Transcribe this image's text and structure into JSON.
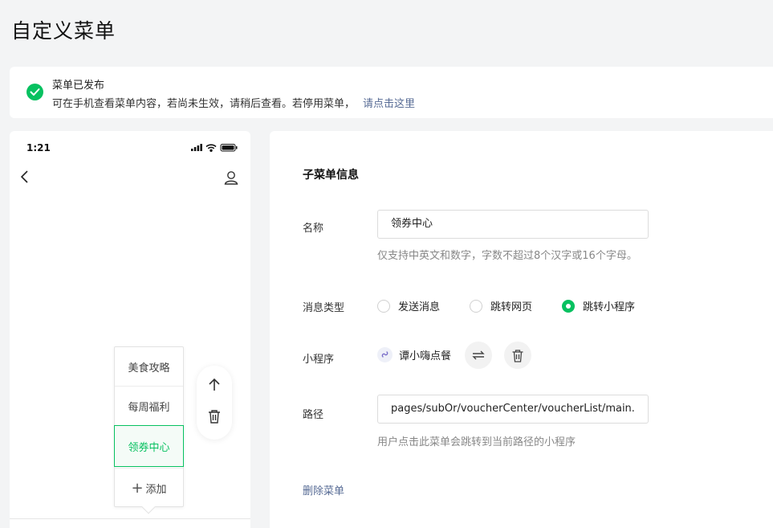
{
  "page": {
    "title": "自定义菜单"
  },
  "notice": {
    "title": "菜单已发布",
    "description": "可在手机查看菜单内容，若尚未生效，请稍后查看。若停用菜单，",
    "link": "请点击这里"
  },
  "phone": {
    "time": "1:21",
    "submenu_items": [
      "美食攻略",
      "每周福利",
      "领券中心"
    ],
    "selected_item": "领券中心",
    "add_label": "添加"
  },
  "panel": {
    "section_title": "子菜单信息",
    "name": {
      "label": "名称",
      "value": "领券中心",
      "hint": "仅支持中英文和数字，字数不超过8个汉字或16个字母。"
    },
    "message_type": {
      "label": "消息类型",
      "options": [
        "发送消息",
        "跳转网页",
        "跳转小程序"
      ],
      "selected": "跳转小程序"
    },
    "mini_program": {
      "label": "小程序",
      "name": "谭小嗨点餐"
    },
    "path": {
      "label": "路径",
      "value": "pages/subOr/voucherCenter/voucherList/main.",
      "hint": "用户点击此菜单会跳转到当前路径的小程序"
    },
    "delete_label": "删除菜单"
  },
  "colors": {
    "accent": "#07c160",
    "link": "#576b95"
  },
  "icons": [
    "check-icon",
    "back-arrow-icon",
    "user-icon",
    "signal-icon",
    "wifi-icon",
    "battery-icon",
    "arrow-up-icon",
    "trash-icon",
    "plus-icon",
    "link-icon",
    "swap-icon"
  ]
}
